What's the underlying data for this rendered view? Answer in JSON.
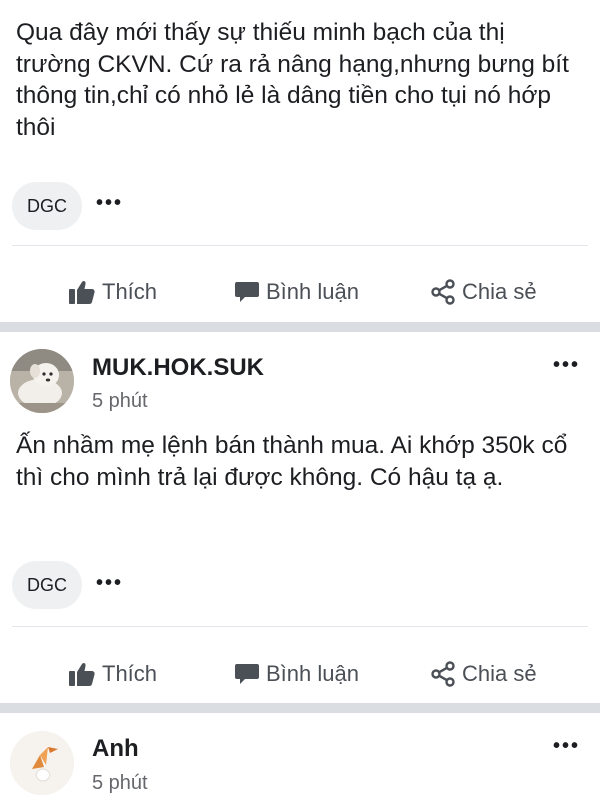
{
  "post1": {
    "text": "Qua đây mới thấy sự thiếu minh bạch của thị trường CKVN. Cứ ra rả nâng hạng,nhưng bưng bít thông tin,chỉ có nhỏ lẻ là dâng tiền cho tụi nó hớp thôi",
    "tag": "DGC",
    "more": "•••"
  },
  "post2": {
    "author": "MUK.HOK.SUK",
    "time": "5 phút",
    "more": "•••",
    "text": "Ấn nhầm mẹ lệnh bán thành mua. Ai khớp 350k cổ thì cho mình trả lại được không. Có hậu tạ ạ.",
    "tag": "DGC",
    "tag_more": "•••"
  },
  "post3": {
    "author": "Anh",
    "time": "5 phút",
    "more": "•••"
  },
  "actions": {
    "like": "Thích",
    "comment": "Bình luận",
    "share": "Chia sẻ"
  },
  "icons": {
    "like": "thumbs-up-icon",
    "comment": "comment-bubble-icon",
    "share": "share-icon",
    "more": "more-dots-icon"
  },
  "colors": {
    "separator": "#dadde1",
    "action_text": "#4b4f56",
    "tag_bg": "#eef0f2"
  }
}
